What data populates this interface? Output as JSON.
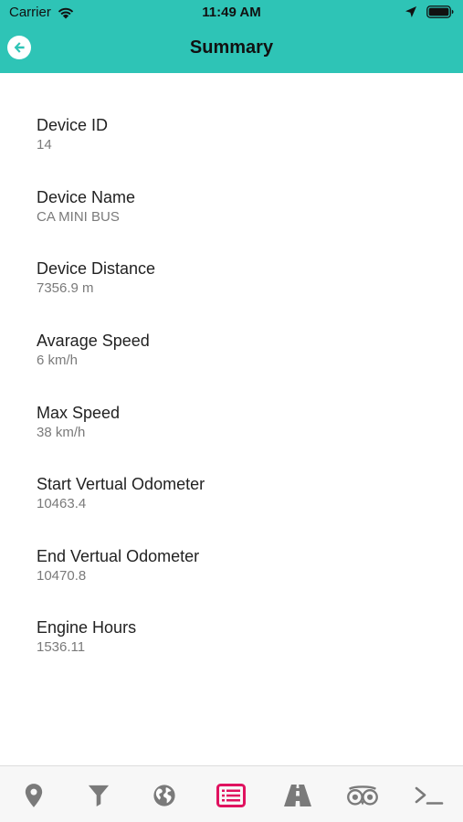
{
  "status_bar": {
    "carrier": "Carrier",
    "time": "11:49 AM"
  },
  "nav": {
    "title": "Summary",
    "back_icon": "arrow-left-circle-icon"
  },
  "summary": {
    "device_id": {
      "label": "Device ID",
      "value": "14"
    },
    "device_name": {
      "label": "Device Name",
      "value": "CA MINI BUS"
    },
    "device_distance": {
      "label": "Device Distance",
      "value": "7356.9 m"
    },
    "average_speed": {
      "label": "Avarage Speed",
      "value": "6 km/h"
    },
    "max_speed": {
      "label": "Max Speed",
      "value": "38 km/h"
    },
    "start_odometer": {
      "label": "Start Vertual Odometer",
      "value": "10463.4"
    },
    "end_odometer": {
      "label": "End Vertual Odometer",
      "value": "10470.8"
    },
    "engine_hours": {
      "label": "Engine Hours",
      "value": "1536.11"
    }
  },
  "tab_bar": {
    "items": [
      {
        "icon": "map-pin-icon",
        "active": false
      },
      {
        "icon": "filter-icon",
        "active": false
      },
      {
        "icon": "globe-icon",
        "active": false
      },
      {
        "icon": "list-icon",
        "active": true
      },
      {
        "icon": "road-icon",
        "active": false
      },
      {
        "icon": "binoculars-icon",
        "active": false
      },
      {
        "icon": "terminal-icon",
        "active": false
      }
    ]
  },
  "colors": {
    "header": "#2ec4b6",
    "tab_active": "#e0125f",
    "tab_inactive": "#7a7a7a"
  }
}
